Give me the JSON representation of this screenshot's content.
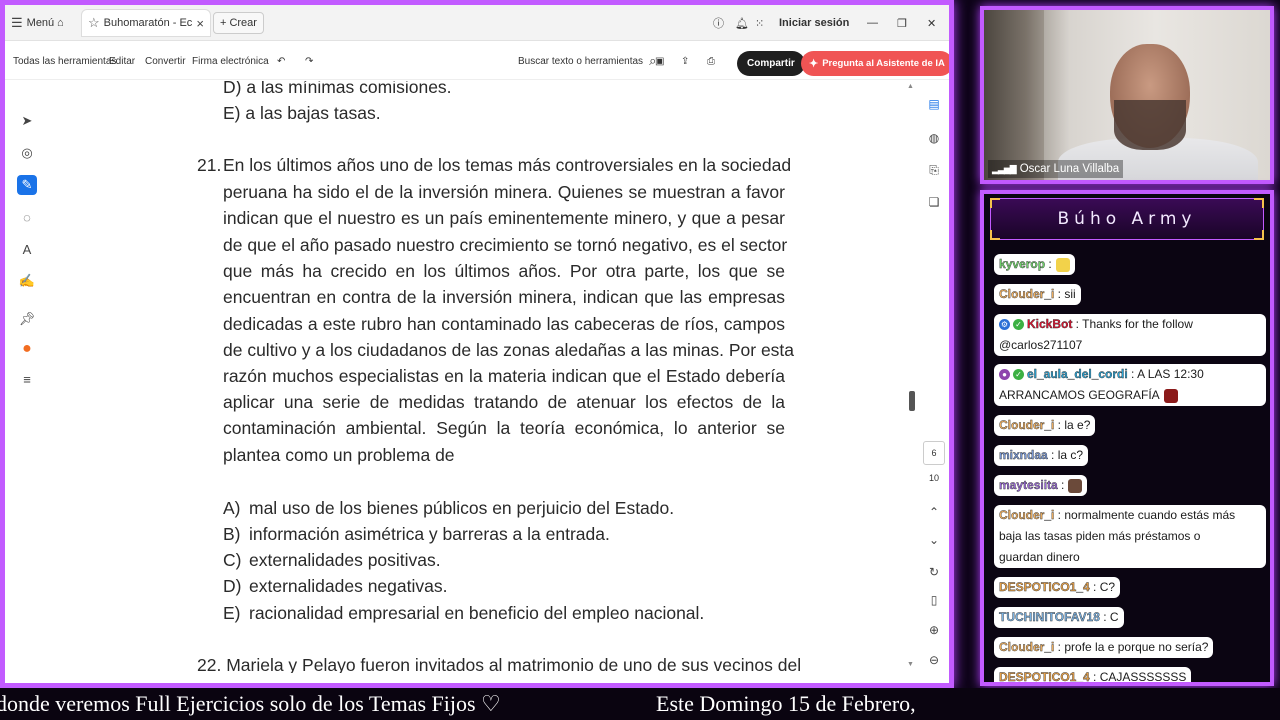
{
  "browser": {
    "menu_label": "Menú",
    "tab_title": "Buhomaratón - Econo...",
    "new_tab_label": "Crear",
    "signin_label": "Iniciar sesión"
  },
  "toolbar": {
    "all_tools": "Todas las herramientas",
    "edit": "Editar",
    "convert": "Convertir",
    "sign": "Firma electrónica",
    "search_placeholder": "Buscar texto o herramientas",
    "share_label": "Compartir",
    "ai_label": "Pregunta al Asistente de IA"
  },
  "document": {
    "prev_options": [
      "D) a las mínimas comisiones.",
      "E) a las bajas tasas."
    ],
    "q21_number": "21.",
    "q21_lines": [
      "En los últimos años uno de los temas más controversiales en la sociedad",
      "peruana ha sido el de la inversión minera. Quienes se muestran a favor",
      "indican que el nuestro es un país eminentemente minero, y que a pesar",
      "de que el año pasado nuestro crecimiento se tornó negativo, es el sector",
      "que más ha crecido en los últimos años. Por otra parte, los que se",
      "encuentran en contra de la inversión minera, indican que las empresas",
      "dedicadas a este rubro han contaminado las cabeceras de ríos, campos",
      "de cultivo y a los ciudadanos de las zonas aledañas a las minas. Por esta",
      "razón muchos especialistas en la materia indican que el Estado debería",
      "aplicar una serie de medidas tratando de atenuar los efectos de la",
      "contaminación ambiental. Según la teoría económica, lo anterior se",
      "plantea como un problema de"
    ],
    "q21_options": [
      {
        "letter": "A)",
        "text": "mal uso de los bienes públicos en perjuicio del Estado."
      },
      {
        "letter": "B)",
        "text": "información asimétrica y barreras a la entrada."
      },
      {
        "letter": "C)",
        "text": "externalidades positivas."
      },
      {
        "letter": "D)",
        "text": "externalidades negativas."
      },
      {
        "letter": "E)",
        "text": "racionalidad empresarial en beneficio del empleo nacional."
      }
    ],
    "q22_line": "22. Mariela y Pelayo fueron invitados al matrimonio de uno de sus vecinos del"
  },
  "page_nav": {
    "current": "6",
    "total": "10"
  },
  "webcam": {
    "name": "Oscar Luna Villalba"
  },
  "chat": {
    "title": "Búho Army",
    "messages": [
      {
        "user": "kyverop",
        "sep": " :",
        "text": "",
        "color": "#6fd36a"
      },
      {
        "user": "Clouder_i",
        "sep": " : ",
        "text": "sii",
        "color": "#f0b060"
      },
      {
        "user": "KickBot",
        "sep": " : ",
        "text": "Thanks for the follow",
        "text2": "@carlos271107",
        "color": "#e0102f"
      },
      {
        "user": "el_aula_del_cordi",
        "sep": " : ",
        "text": "A LAS 12:30",
        "text2": "ARRANCAMOS GEOGRAFÍA",
        "color": "#2aa4d6"
      },
      {
        "user": "Clouder_i",
        "sep": " : ",
        "text": "la e?",
        "color": "#f0b060"
      },
      {
        "user": "mixndaa",
        "sep": " : ",
        "text": "la c?",
        "color": "#7a9ad8"
      },
      {
        "user": "maytesiita",
        "sep": " :",
        "text": "",
        "color": "#9a6ad8"
      },
      {
        "user": "Clouder_i",
        "sep": " : ",
        "text": "normalmente cuando estás más",
        "text2": "baja las tasas piden más préstamos o",
        "text3": "guardan dinero",
        "color": "#f0b060"
      },
      {
        "user": "DESPOTICO1_4",
        "sep": " : ",
        "text": "C?",
        "color": "#e8a24a"
      },
      {
        "user": "TUCHINITOFAV18",
        "sep": " : ",
        "text": "C",
        "color": "#7ab0e0"
      },
      {
        "user": "Clouder_i",
        "sep": " : ",
        "text": "profe la e porque no sería?",
        "color": "#f0b060"
      },
      {
        "user": "DESPOTICO1_4",
        "sep": " : ",
        "text": "CAJASSSSSSS",
        "color": "#e8a24a"
      }
    ]
  },
  "ticker": {
    "left": "donde veremos Full Ejercicios solo de los Temas Fijos ♡",
    "right": "Este Domingo 15 de Febrero,"
  },
  "colors": {
    "accent": "#c25bff",
    "share_btn": "#1f1f1f",
    "ai_btn": "#f05454",
    "pen_tool": "#1a73e8"
  }
}
